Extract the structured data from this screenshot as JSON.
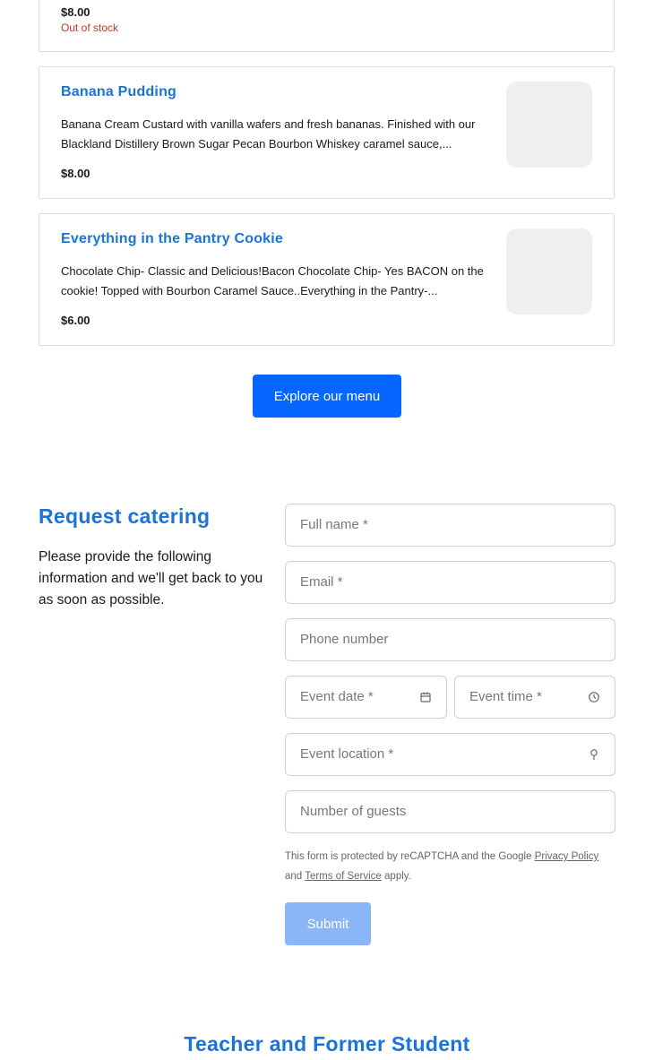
{
  "top_item": {
    "price": "$8.00",
    "stock_status": "Out of stock"
  },
  "items": [
    {
      "title": "Banana Pudding",
      "description": "Banana Cream Custard with vanilla wafers and fresh bananas. Finished with our Blackland Distillery Brown Sugar Pecan Bourbon Whiskey caramel sauce,...",
      "price": "$8.00"
    },
    {
      "title": "Everything in the Pantry Cookie",
      "description": "Chocolate Chip- Classic and Delicious!Bacon Chocolate Chip- Yes BACON on the cookie! Topped with Bourbon Caramel Sauce..Everything in the Pantry-...",
      "price": "$6.00"
    }
  ],
  "explore_button": "Explore our menu",
  "catering": {
    "title": "Request catering",
    "description": "Please provide the following information and we'll get back to you as soon as possible.",
    "fields": {
      "full_name": "Full name *",
      "email": "Email *",
      "phone": "Phone number",
      "event_date": "Event date *",
      "event_time": "Event time *",
      "event_location": "Event location *",
      "guests": "Number of guests"
    },
    "recaptcha": {
      "prefix": "This form is protected by reCAPTCHA and the Google ",
      "privacy": "Privacy Policy",
      "and": " and ",
      "terms": "Terms of Service",
      "suffix": " apply."
    },
    "submit": "Submit"
  },
  "footer_title": "Teacher and Former Student",
  "colors": {
    "accent": "#1a73d9",
    "button": "#0567ff",
    "submit_disabled": "#8ab5f7",
    "out_of_stock": "#c0392b"
  },
  "icons": {
    "event_date": "calendar-icon",
    "event_time": "clock-icon",
    "event_location": "location-pin-icon"
  }
}
